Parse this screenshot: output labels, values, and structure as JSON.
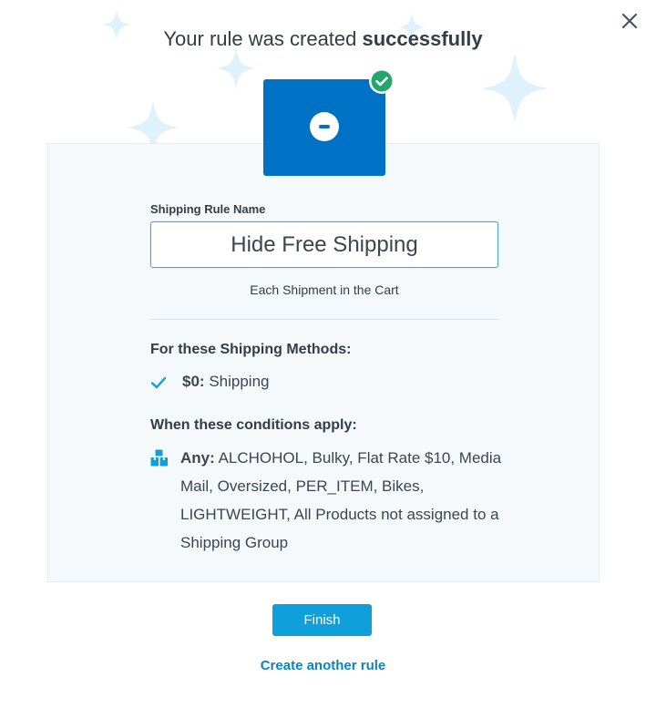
{
  "dialog": {
    "title_prefix": "Your rule was created ",
    "title_emphasis": "successfully",
    "close_icon": "close-icon"
  },
  "rule_tile": {
    "icon": "minus-circle-icon",
    "badge_icon": "check-circle-icon",
    "tile_color": "#0072c6",
    "badge_color": "#22a66b"
  },
  "form": {
    "name_label": "Shipping Rule Name",
    "name_value": "Hide Free Shipping",
    "scope": "Each Shipment in the Cart"
  },
  "methods": {
    "heading": "For these Shipping Methods:",
    "items": [
      {
        "icon": "check-icon",
        "price": "$0:",
        "name": "Shipping"
      }
    ]
  },
  "conditions": {
    "heading": "When these conditions apply:",
    "icon": "boxes-icon",
    "prefix": "Any:",
    "text": "ALCHOHOL, Bulky, Flat Rate $10, Media Mail, Oversized, PER_ITEM, Bikes, LIGHTWEIGHT, All Products not assigned to a Shipping Group"
  },
  "actions": {
    "finish_label": "Finish",
    "create_another_label": "Create another rule"
  },
  "colors": {
    "accent": "#0f9fdb",
    "link": "#0a83c4",
    "sparkle": "#dff1fb"
  }
}
